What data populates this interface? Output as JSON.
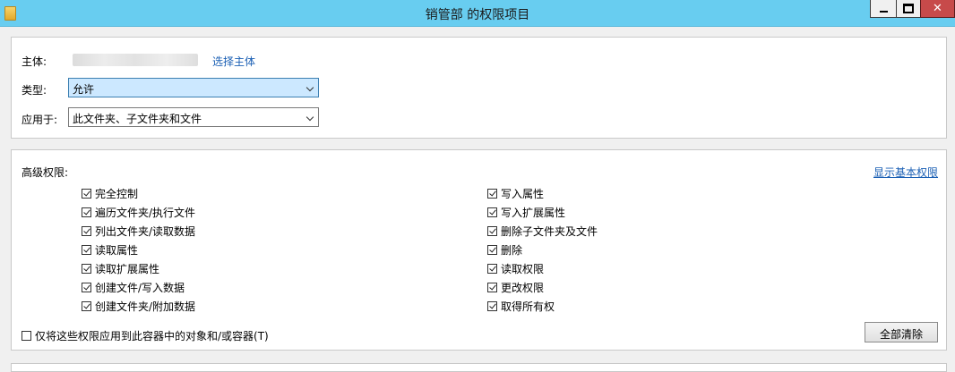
{
  "window": {
    "title": "销管部 的权限项目",
    "close_glyph": "✕"
  },
  "principal": {
    "label": "主体:",
    "select_link": "选择主体"
  },
  "type": {
    "label": "类型:",
    "value": "允许"
  },
  "applies_to": {
    "label": "应用于:",
    "value": "此文件夹、子文件夹和文件"
  },
  "advanced": {
    "title": "高级权限:",
    "show_basic_link": "显示基本权限",
    "left_permissions": [
      {
        "label": "完全控制",
        "checked": true
      },
      {
        "label": "遍历文件夹/执行文件",
        "checked": true
      },
      {
        "label": "列出文件夹/读取数据",
        "checked": true
      },
      {
        "label": "读取属性",
        "checked": true
      },
      {
        "label": "读取扩展属性",
        "checked": true
      },
      {
        "label": "创建文件/写入数据",
        "checked": true
      },
      {
        "label": "创建文件夹/附加数据",
        "checked": true
      }
    ],
    "right_permissions": [
      {
        "label": "写入属性",
        "checked": true
      },
      {
        "label": "写入扩展属性",
        "checked": true
      },
      {
        "label": "删除子文件夹及文件",
        "checked": true
      },
      {
        "label": "删除",
        "checked": true
      },
      {
        "label": "读取权限",
        "checked": true
      },
      {
        "label": "更改权限",
        "checked": true
      },
      {
        "label": "取得所有权",
        "checked": true
      }
    ],
    "apply_only_label": "仅将这些权限应用到此容器中的对象和/或容器(T)",
    "apply_only_checked": false,
    "clear_all_button": "全部清除"
  }
}
